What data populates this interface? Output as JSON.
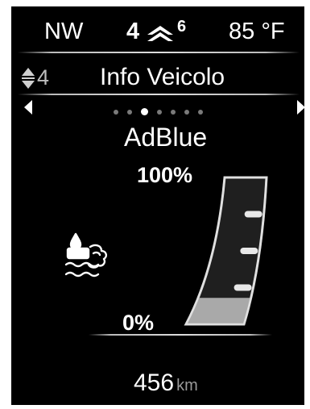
{
  "status_bar": {
    "compass": "NW",
    "gear_current": "4",
    "gear_next": "6",
    "temperature": "85 °F"
  },
  "menu": {
    "side_index": "4",
    "title": "Info Veicolo",
    "pages_total": 7,
    "active_page": 3
  },
  "screen": {
    "title": "AdBlue",
    "gauge": {
      "max_label": "100%",
      "min_label": "0%",
      "fill_level": 0.18,
      "marker_count": 3
    },
    "range": {
      "value": "456",
      "unit": "km"
    },
    "colors": {
      "background": "#000000",
      "text": "#ffffff",
      "inactive_dot": "#7a7a7a"
    },
    "icons": {
      "category": "adblue-fluid-icon"
    }
  }
}
